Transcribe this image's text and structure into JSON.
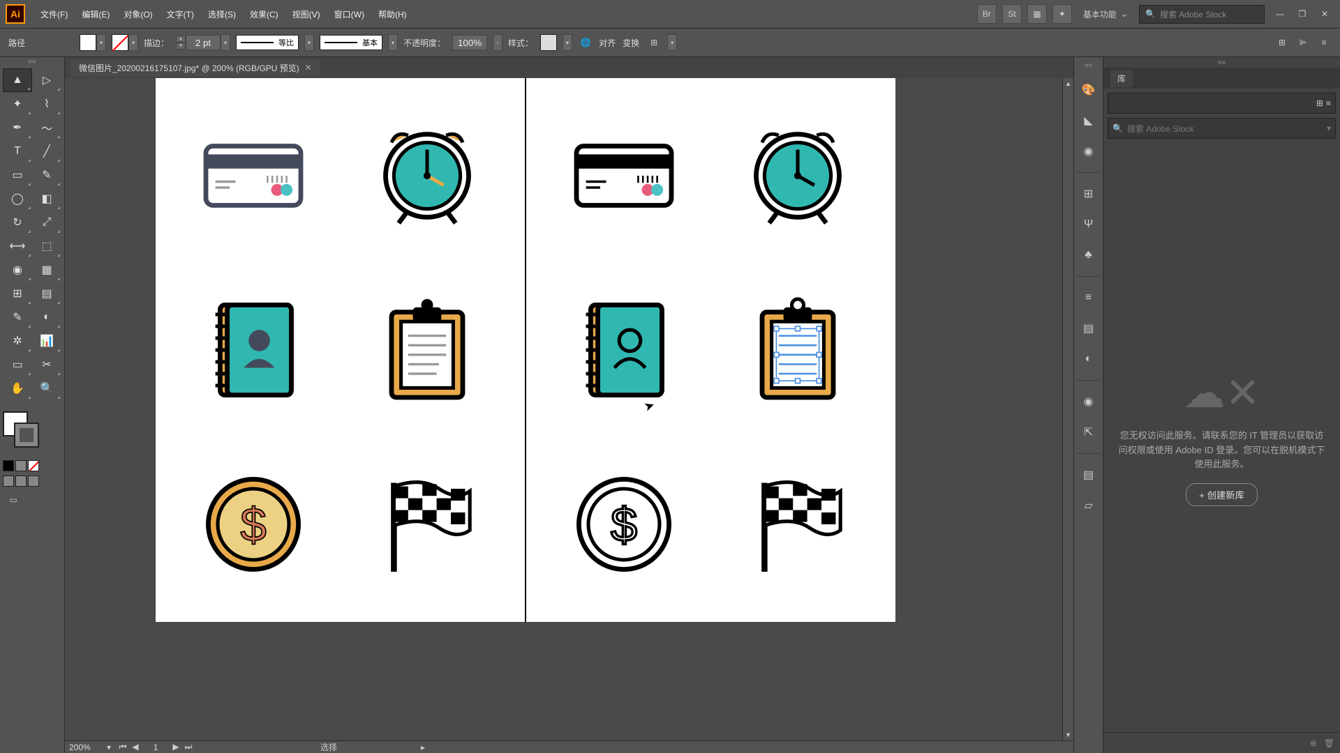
{
  "app": {
    "logo": "Ai"
  },
  "menu": {
    "file": "文件(F)",
    "edit": "编辑(E)",
    "object": "对象(O)",
    "type": "文字(T)",
    "select": "选择(S)",
    "effect": "效果(C)",
    "view": "视图(V)",
    "window": "窗口(W)",
    "help": "帮助(H)"
  },
  "menubar_right": {
    "workspace": "基本功能",
    "search_placeholder": "搜索 Adobe Stock"
  },
  "controlbar": {
    "selection_label": "路径",
    "stroke_label": "描边：",
    "stroke_weight": "2 pt",
    "stroke_profile": "等比",
    "stroke_style": "基本",
    "opacity_label": "不透明度：",
    "opacity_value": "100%",
    "style_label": "样式：",
    "align_label": "对齐",
    "transform_label": "变换"
  },
  "document": {
    "tab_title": "微信图片_20200216175107.jpg* @ 200% (RGB/GPU 预览)"
  },
  "status": {
    "zoom": "200%",
    "artboard_num": "1",
    "select_label": "选择"
  },
  "lib": {
    "tab": "库",
    "search_placeholder": "搜索 Adobe Stock",
    "message": "您无权访问此服务。请联系您的 IT 管理员以获取访问权限或使用 Adobe ID 登录。您可以在脱机模式下使用此服务。",
    "create_button": "+ 创建新库"
  },
  "canvas": {
    "icons_left": [
      {
        "name": "credit-card-color"
      },
      {
        "name": "alarm-clock-color"
      },
      {
        "name": "contact-book-color"
      },
      {
        "name": "clipboard-color"
      },
      {
        "name": "coin-dollar-color"
      },
      {
        "name": "checkered-flag-color"
      }
    ],
    "icons_right": [
      {
        "name": "credit-card-line"
      },
      {
        "name": "alarm-clock-line"
      },
      {
        "name": "contact-book-line"
      },
      {
        "name": "clipboard-line-selected"
      },
      {
        "name": "coin-dollar-line"
      },
      {
        "name": "checkered-flag-line"
      }
    ]
  }
}
